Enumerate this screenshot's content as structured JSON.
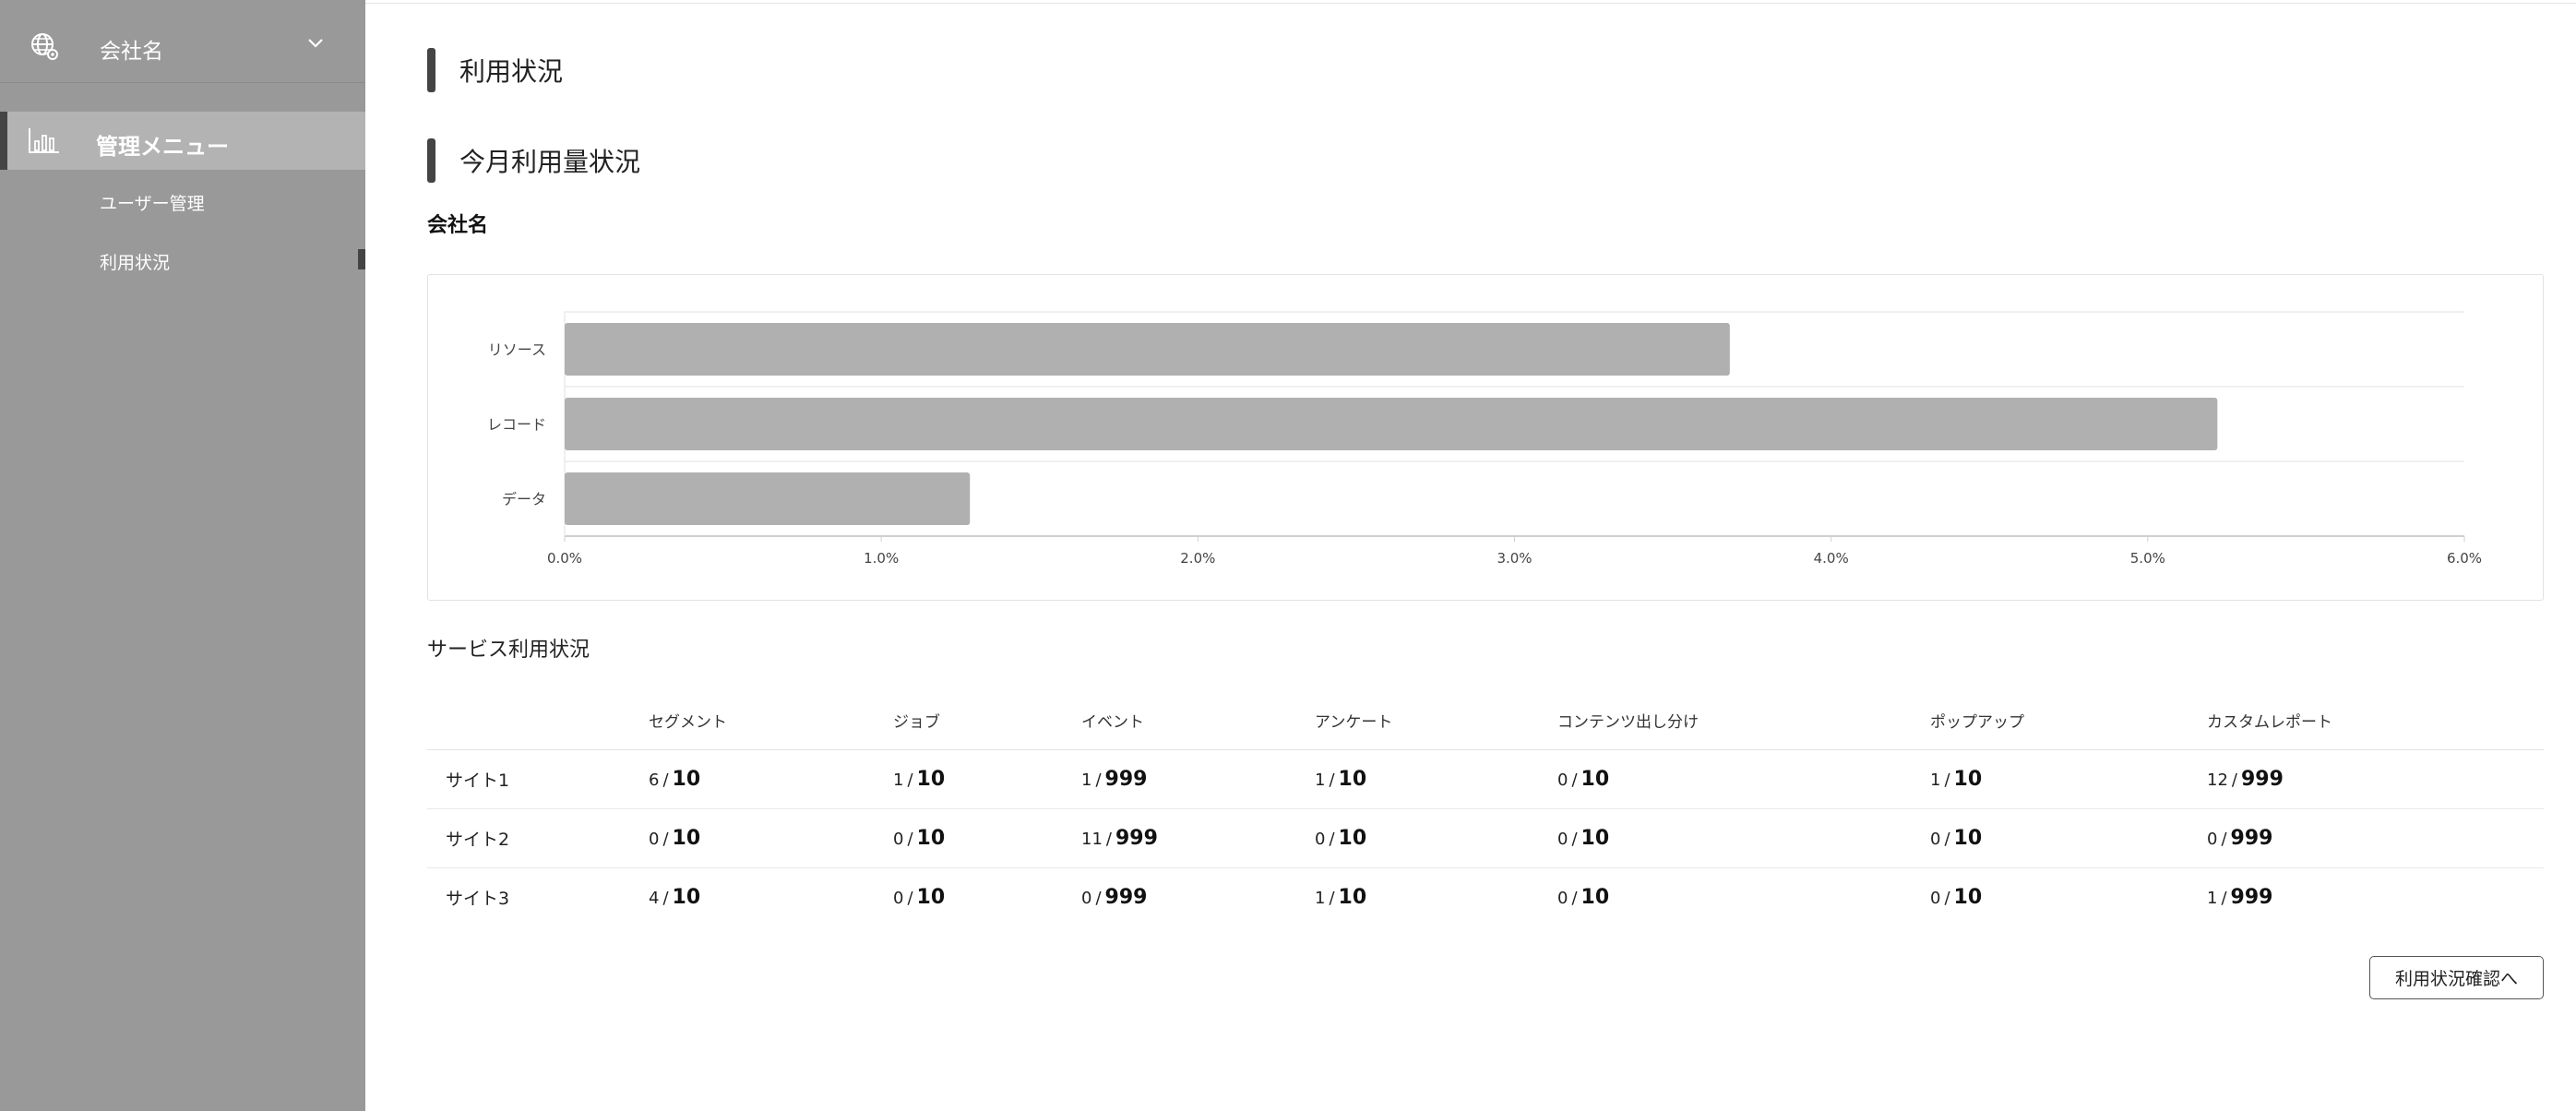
{
  "sidebar": {
    "company_name": "会社名",
    "menu_label": "管理メニュー",
    "items": [
      {
        "label": "ユーザー管理"
      },
      {
        "label": "利用状況"
      }
    ],
    "icons": {
      "company": "globe-icon",
      "menu": "bar-chart-icon",
      "dropdown": "chevron-down-icon"
    }
  },
  "main": {
    "page_title": "利用状況",
    "section_title": "今月利用量状況",
    "company_label": "会社名",
    "service_title": "サービス利用状況",
    "confirm_button": "利用状況確認へ"
  },
  "chart_data": {
    "type": "bar",
    "orientation": "horizontal",
    "categories": [
      "リソース",
      "レコード",
      "データ"
    ],
    "values": [
      3.68,
      5.22,
      1.28
    ],
    "xlim": [
      0,
      6
    ],
    "x_ticks": [
      "0.0%",
      "1.0%",
      "2.0%",
      "3.0%",
      "4.0%",
      "5.0%",
      "6.0%"
    ],
    "grid": true,
    "bar_color": "#b0b0b0"
  },
  "table": {
    "headers": [
      "",
      "セグメント",
      "ジョブ",
      "イベント",
      "アンケート",
      "コンテンツ出し分け",
      "ポップアップ",
      "カスタムレポート"
    ],
    "rows": [
      {
        "site": "サイト1",
        "cells": [
          {
            "used": "6",
            "limit": "10"
          },
          {
            "used": "1",
            "limit": "10"
          },
          {
            "used": "1",
            "limit": "999"
          },
          {
            "used": "1",
            "limit": "10"
          },
          {
            "used": "0",
            "limit": "10"
          },
          {
            "used": "1",
            "limit": "10"
          },
          {
            "used": "12",
            "limit": "999"
          }
        ]
      },
      {
        "site": "サイト2",
        "cells": [
          {
            "used": "0",
            "limit": "10"
          },
          {
            "used": "0",
            "limit": "10"
          },
          {
            "used": "11",
            "limit": "999"
          },
          {
            "used": "0",
            "limit": "10"
          },
          {
            "used": "0",
            "limit": "10"
          },
          {
            "used": "0",
            "limit": "10"
          },
          {
            "used": "0",
            "limit": "999"
          }
        ]
      },
      {
        "site": "サイト3",
        "cells": [
          {
            "used": "4",
            "limit": "10"
          },
          {
            "used": "0",
            "limit": "10"
          },
          {
            "used": "0",
            "limit": "999"
          },
          {
            "used": "1",
            "limit": "10"
          },
          {
            "used": "0",
            "limit": "10"
          },
          {
            "used": "0",
            "limit": "10"
          },
          {
            "used": "1",
            "limit": "999"
          }
        ]
      }
    ]
  },
  "colors": {
    "sidebar_bg": "#999999",
    "menu_active_bg": "#b3b3b3",
    "accent": "#444444"
  }
}
